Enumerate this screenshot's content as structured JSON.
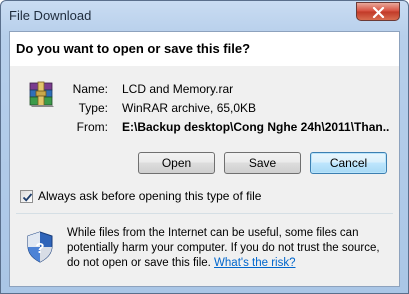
{
  "window": {
    "title": "File Download"
  },
  "dialog": {
    "question": "Do you want to open or save this file?",
    "file_icon": "winrar-archive-icon",
    "name_label": "Name:",
    "name_value": "LCD and Memory.rar",
    "type_label": "Type:",
    "type_value": "WinRAR archive, 65,0KB",
    "from_label": "From:",
    "from_value": "E:\\Backup desktop\\Cong Nghe 24h\\2011\\Than..."
  },
  "buttons": {
    "open": "Open",
    "save": "Save",
    "cancel": "Cancel"
  },
  "checkbox": {
    "label": "Always ask before opening this type of file",
    "checked": true
  },
  "warning": {
    "icon": "security-shield-icon",
    "text": "While files from the Internet can be useful, some files can potentially harm your computer. If you do not trust the source, do not open or save this file.",
    "link": "What's the risk?"
  },
  "colors": {
    "link": "#0066cc",
    "close_button": "#c13a28",
    "default_button_border": "#3c7fb1"
  }
}
